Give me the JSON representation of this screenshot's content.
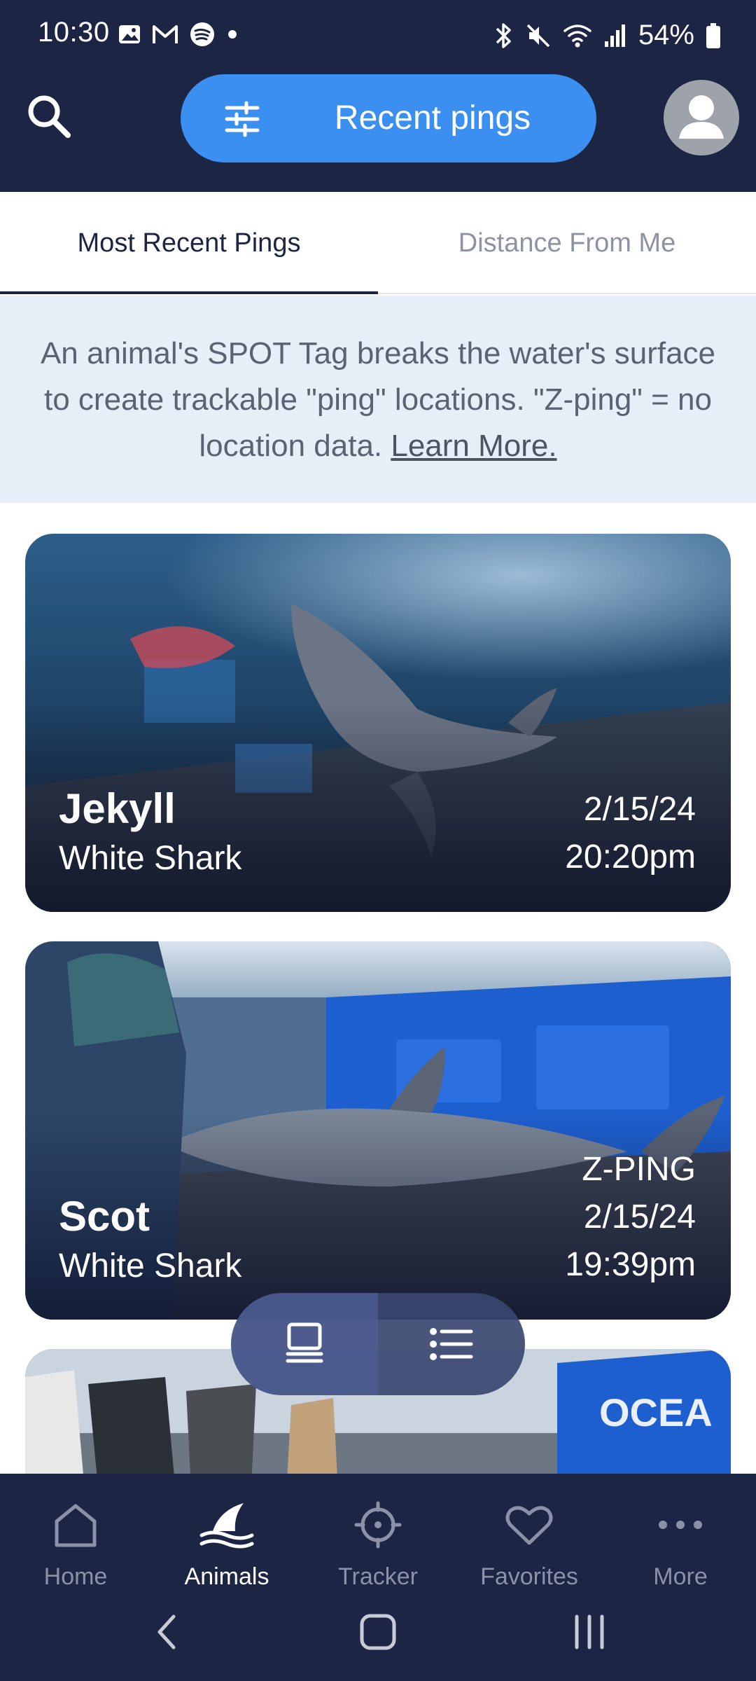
{
  "status_bar": {
    "time": "10:30",
    "battery": "54%"
  },
  "header": {
    "filter_label": "Recent pings"
  },
  "tabs": [
    {
      "label": "Most Recent Pings",
      "active": true
    },
    {
      "label": "Distance From Me",
      "active": false
    }
  ],
  "info_banner": {
    "text": "An animal's SPOT Tag breaks the water's surface to create trackable \"ping\" locations. \"Z-ping\" = no location data.",
    "link": "Learn More."
  },
  "cards": [
    {
      "name": "Jekyll",
      "species": "White Shark",
      "date": "2/15/24",
      "time": "20:20pm"
    },
    {
      "name": "Scot",
      "species": "White Shark",
      "tag": "Z-PING",
      "date": "2/15/24",
      "time": "19:39pm"
    }
  ],
  "bottom_nav": [
    {
      "label": "Home",
      "icon": "home-icon",
      "active": false
    },
    {
      "label": "Animals",
      "icon": "shark-fin-icon",
      "active": true
    },
    {
      "label": "Tracker",
      "icon": "tracker-icon",
      "active": false
    },
    {
      "label": "Favorites",
      "icon": "heart-icon",
      "active": false
    },
    {
      "label": "More",
      "icon": "more-icon",
      "active": false
    }
  ],
  "colors": {
    "navy": "#1d2544",
    "accent": "#3b8ff0",
    "banner_bg": "#e6eff8"
  }
}
